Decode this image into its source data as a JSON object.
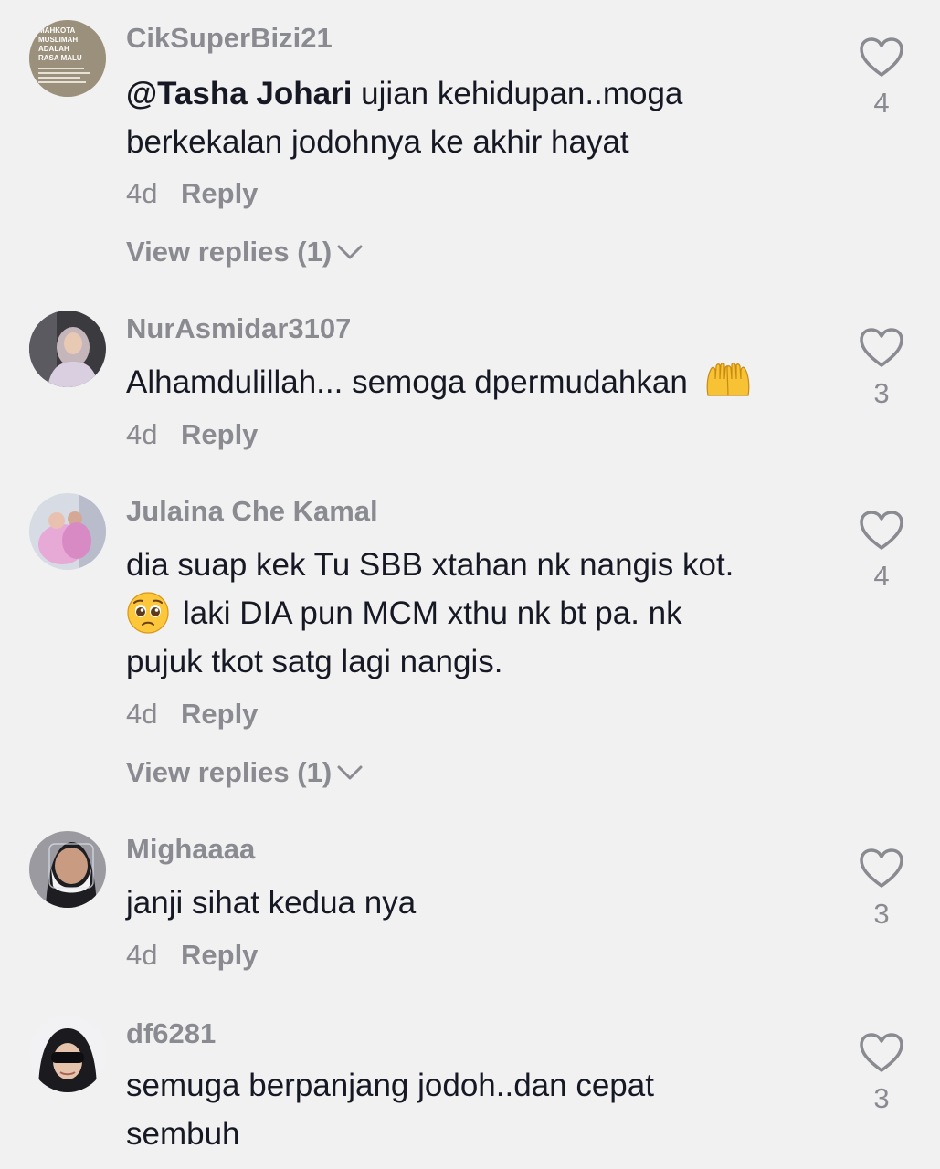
{
  "comments": [
    {
      "username": "CikSuperBizi21",
      "mention": "@Tasha Johari",
      "text_line1": " ujian kehidupan..moga",
      "text_line2": "berkekalan jodohnya ke akhir hayat",
      "date": "4d",
      "reply_label": "Reply",
      "view_replies": "View replies (1)",
      "likes": "4",
      "avatar_text": [
        "MAHKOTA",
        "MUSLIMAH",
        "ADALAH",
        "RASA MALU"
      ]
    },
    {
      "username": "NurAsmidar3107",
      "text_line1": "Alhamdulillah... semoga dpermudahkan",
      "emoji": "palms-up-together-emoji",
      "date": "4d",
      "reply_label": "Reply",
      "likes": "3"
    },
    {
      "username": "Julaina Che Kamal",
      "text_line1": "dia suap kek Tu SBB xtahan nk nangis kot.",
      "text_line2": "laki DIA pun MCM xthu nk bt pa. nk",
      "text_line3": "pujuk tkot satg lagi nangis.",
      "emoji": "pleading-face-emoji",
      "date": "4d",
      "reply_label": "Reply",
      "view_replies": "View replies (1)",
      "likes": "4"
    },
    {
      "username": "Mighaaaa",
      "text_line1": "janji sihat kedua nya",
      "date": "4d",
      "reply_label": "Reply",
      "likes": "3"
    },
    {
      "username": "df6281",
      "text_line1": "semuga berpanjang jodoh..dan cepat",
      "text_line2": "sembuh",
      "likes": "3"
    }
  ],
  "colors": {
    "background": "#f1f1f2",
    "text_primary": "#161823",
    "text_secondary": "#8a8b91"
  },
  "icons": {
    "like": "heart-outline-icon",
    "expand": "chevron-down-icon"
  }
}
